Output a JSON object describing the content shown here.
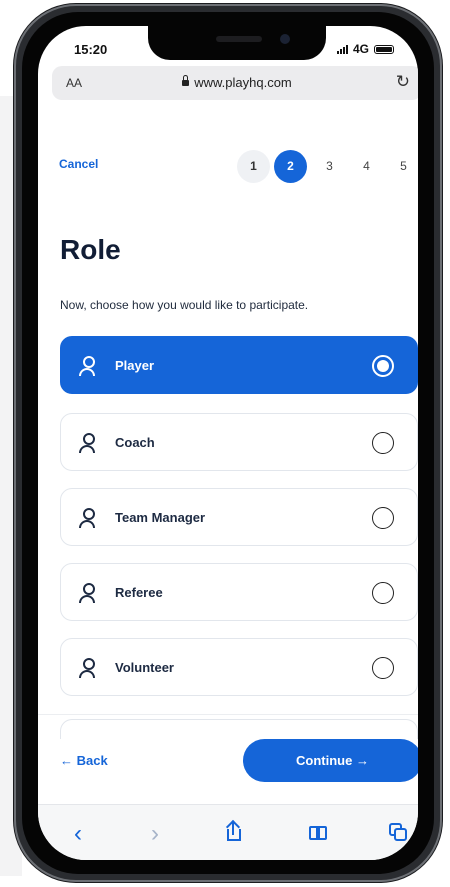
{
  "status_bar": {
    "time": "15:20",
    "network": "4G"
  },
  "browser": {
    "aa_label": "AA",
    "url": "www.playhq.com"
  },
  "header": {
    "cancel_label": "Cancel",
    "steps": [
      "1",
      "2",
      "3",
      "4",
      "5"
    ],
    "current_step": "2"
  },
  "page": {
    "title": "Role",
    "subtitle": "Now, choose how you would like to participate."
  },
  "roles": [
    {
      "label": "Player",
      "selected": true,
      "icon": "user-icon"
    },
    {
      "label": "Coach",
      "selected": false,
      "icon": "user-icon"
    },
    {
      "label": "Team Manager",
      "selected": false,
      "icon": "user-icon"
    },
    {
      "label": "Referee",
      "selected": false,
      "icon": "user-icon"
    },
    {
      "label": "Volunteer",
      "selected": false,
      "icon": "user-icon"
    }
  ],
  "footer": {
    "back_label": "← Back",
    "continue_label": "Continue →"
  },
  "browser_toolbar": {
    "back_icon": "chevron-left-icon",
    "forward_icon": "chevron-right-icon",
    "share_icon": "share-icon",
    "bookmarks_icon": "book-icon",
    "tabs_icon": "tabs-icon"
  },
  "colors": {
    "primary": "#1565d8",
    "text_dark": "#111d35",
    "option_border": "#e2e6ec"
  }
}
